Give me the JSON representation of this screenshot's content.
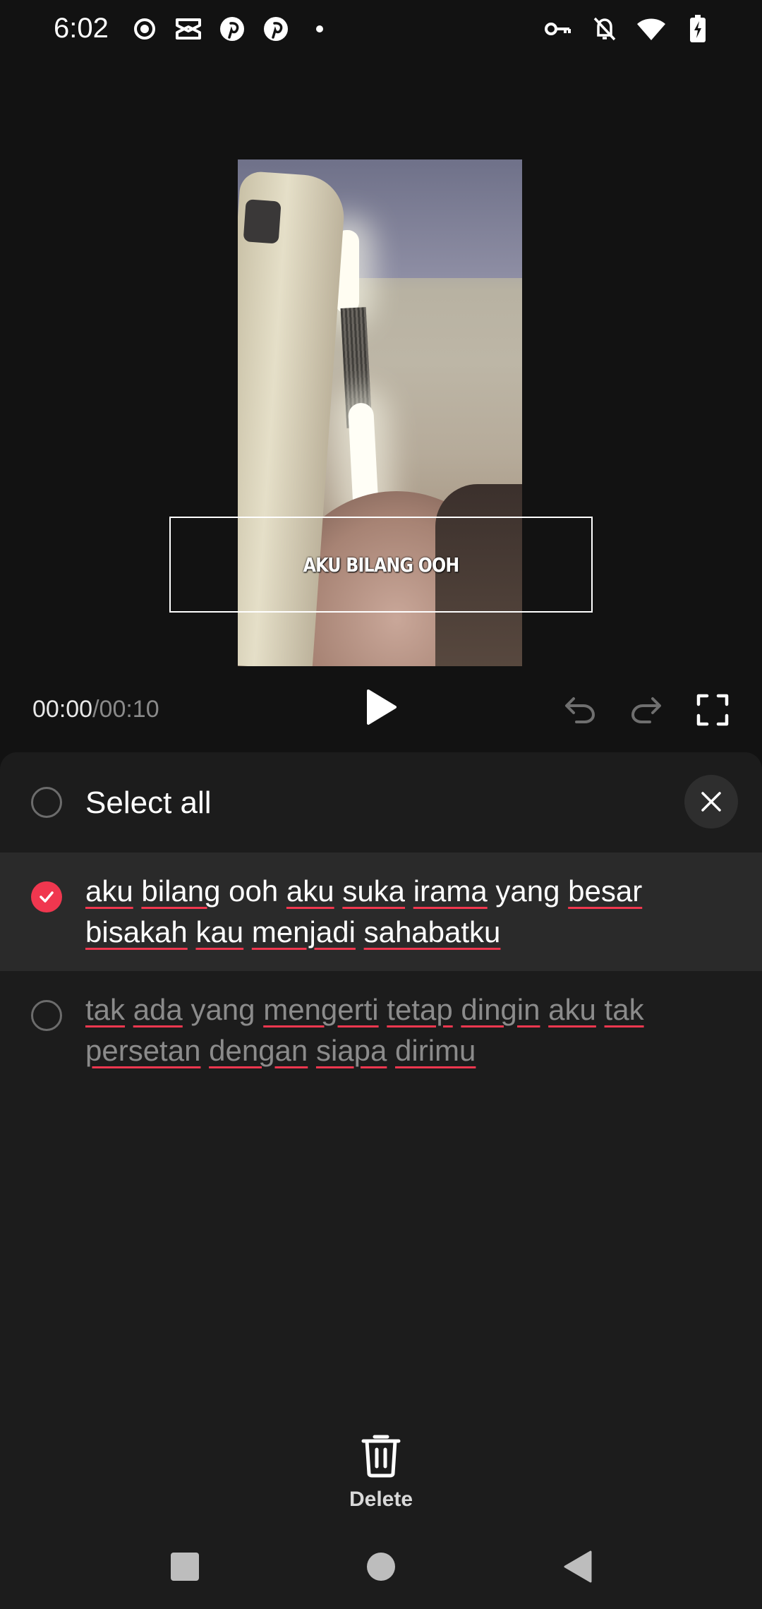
{
  "status_bar": {
    "time": "6:02",
    "left_icons": [
      "record-icon",
      "capcut-icon",
      "pinterest-icon",
      "pinterest-icon",
      "dot-icon"
    ],
    "right_icons": [
      "vpn-key-icon",
      "bell-off-icon",
      "wifi-icon",
      "battery-charging-icon"
    ]
  },
  "preview": {
    "caption": "AKU BILANG OOH"
  },
  "player": {
    "current_time": "00:00",
    "separator": "/",
    "total_time": "00:10"
  },
  "sheet": {
    "select_all_label": "Select all",
    "items": [
      {
        "selected": true,
        "line1": [
          "aku",
          "bilang",
          "ooh",
          "aku",
          "suka",
          "irama",
          "yang",
          "besar"
        ],
        "line2": [
          "bisakah",
          "kau",
          "menjadi",
          "sahabatku"
        ]
      },
      {
        "selected": false,
        "line1": [
          "tak",
          "ada",
          "yang",
          "mengerti",
          "tetap",
          "dingin",
          "aku",
          "tak"
        ],
        "line2": [
          "persetan",
          "dengan",
          "siapa",
          "dirimu"
        ]
      }
    ],
    "delete_label": "Delete"
  },
  "colors": {
    "accent": "#f0374f",
    "background": "#121212",
    "sheet": "#1c1c1c",
    "selected_row": "#2a2a2a"
  }
}
